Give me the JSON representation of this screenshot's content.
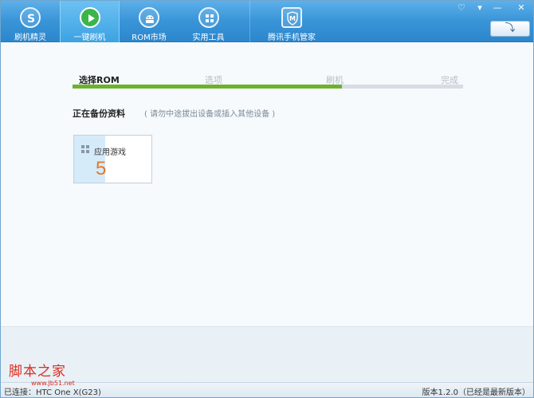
{
  "nav": {
    "items": [
      {
        "label": "刷机精灵",
        "icon": "s-logo-icon"
      },
      {
        "label": "一键刷机",
        "icon": "play-icon"
      },
      {
        "label": "ROM市场",
        "icon": "android-icon"
      },
      {
        "label": "实用工具",
        "icon": "tools-grid-icon"
      },
      {
        "label": "腾讯手机管家",
        "icon": "shield-m-icon"
      }
    ],
    "active_index": 1
  },
  "window_controls": {
    "feedback": "♡",
    "menu": "▾",
    "minimize": "—",
    "close": "✕"
  },
  "back_button": {
    "icon": "return-arrow-icon",
    "glyph": "⤵"
  },
  "steps": {
    "items": [
      "选择ROM",
      "选项",
      "刷机",
      "完成"
    ],
    "current_index": 0,
    "progress_fraction": 0.69
  },
  "status": {
    "title": "正在备份资料",
    "hint": "( 请勿中途拔出设备或插入其他设备 )"
  },
  "backup_card": {
    "label": "应用游戏",
    "count": "5",
    "progress_fraction": 0.4
  },
  "statusbar": {
    "connection": "已连接：HTC One X(G23)",
    "version": "版本1.2.0（已经是最新版本）"
  },
  "watermark": {
    "main": "脚本之家",
    "sub": "www.Jb51.net"
  },
  "colors": {
    "nav_gradient_top": "#5db0ea",
    "nav_gradient_bottom": "#2c86cc",
    "progress_green": "#6cb32a",
    "count_orange": "#e07a2a",
    "watermark_red": "#e02a1a"
  }
}
